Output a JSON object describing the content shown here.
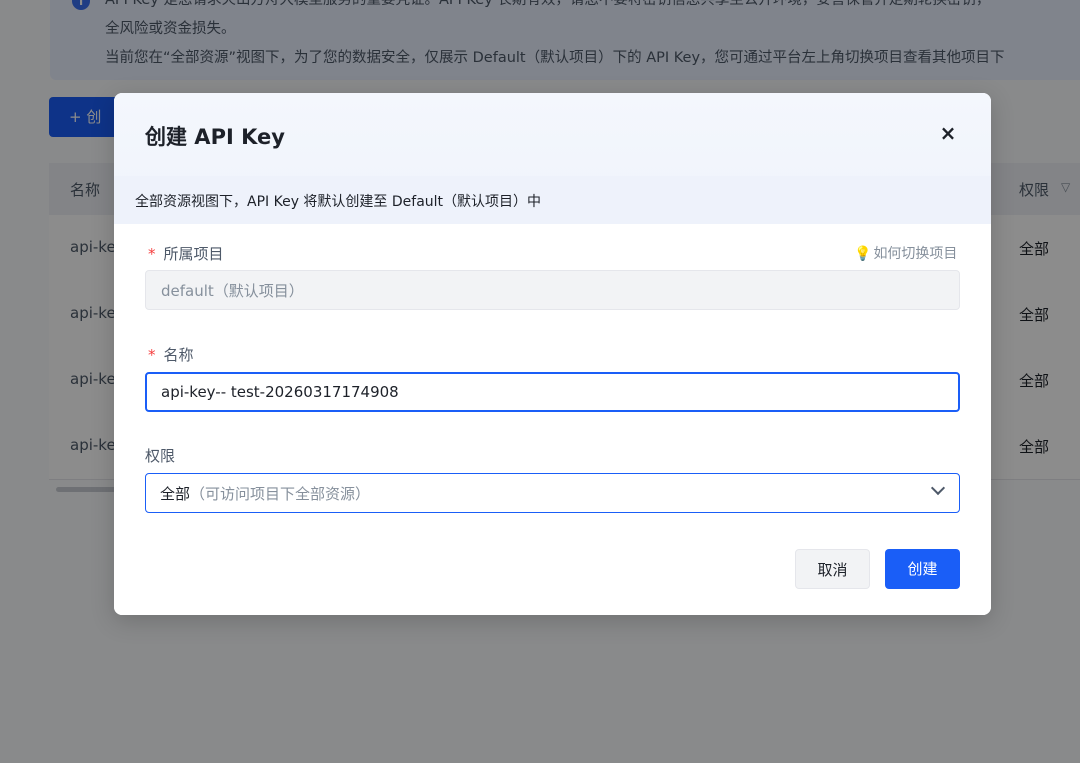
{
  "background": {
    "notice_lines": [
      "API Key 是您请求火山方舟大模型服务的重要凭证。API Key 长期有效，请您不要将密钥信息共享至公开环境，妥善保管并定期轮换密钥，",
      "全风险或资金损失。",
      "当前您在“全部资源”视图下，为了您的数据安全，仅展示 Default（默认项目）下的 API Key，您可通过平台左上角切换项目查看其他项目下"
    ],
    "create_button": "+ 创",
    "table": {
      "columns": [
        "名称",
        "权限"
      ],
      "rows": [
        {
          "name": "api-ke",
          "permission": "全部"
        },
        {
          "name": "api-ke",
          "permission": "全部"
        },
        {
          "name": "api-ke",
          "permission": "全部"
        },
        {
          "name": "api-ke",
          "permission": "全部"
        }
      ]
    }
  },
  "modal": {
    "title": "创建 API Key",
    "close_icon": "×",
    "hint": "全部资源视图下，API Key 将默认创建至 Default（默认项目）中",
    "project": {
      "required_mark": "*",
      "label": "所属项目",
      "help_link": "如何切换项目",
      "value": "default（默认项目）"
    },
    "name": {
      "required_mark": "*",
      "label": "名称",
      "value": "api-key-- test-20260317174908"
    },
    "permission": {
      "label": "权限",
      "value": "全部",
      "description": "（可访问项目下全部资源）"
    },
    "buttons": {
      "cancel": "取消",
      "create": "创建"
    }
  },
  "colors": {
    "primary": "#1a5ef7",
    "required": "#f53f3f",
    "overlay": "rgba(0,0,0,0.45)"
  }
}
